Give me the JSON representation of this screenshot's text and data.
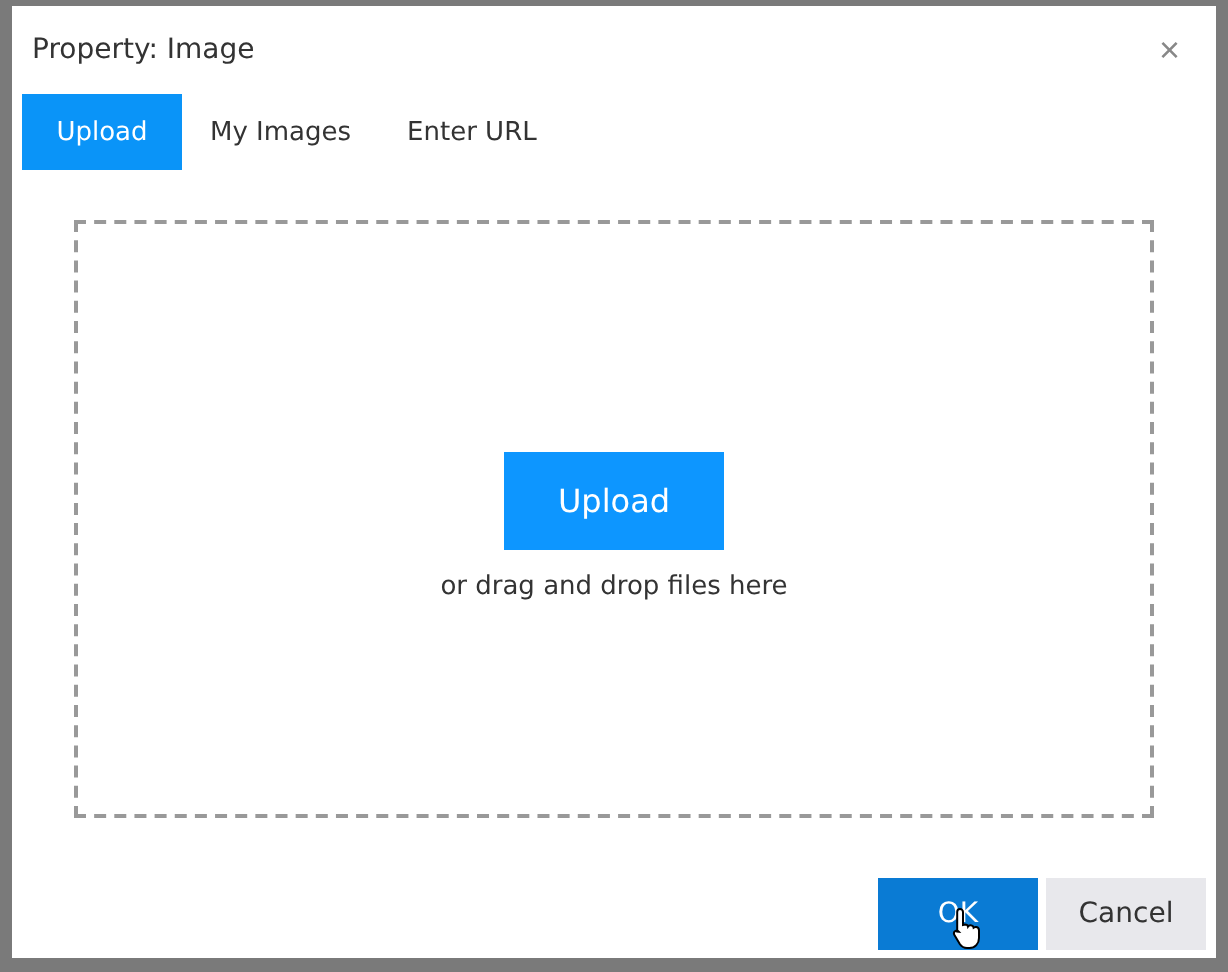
{
  "dialog": {
    "title": "Property: Image",
    "close": "×"
  },
  "tabs": [
    {
      "label": "Upload",
      "selected": true
    },
    {
      "label": "My Images",
      "selected": false
    },
    {
      "label": "Enter URL",
      "selected": false
    }
  ],
  "upload": {
    "button": "Upload",
    "hint": "or drag and drop files here"
  },
  "buttons": [
    {
      "label": "OK",
      "kind": "primary"
    },
    {
      "label": "Cancel",
      "kind": "secondary"
    }
  ]
}
